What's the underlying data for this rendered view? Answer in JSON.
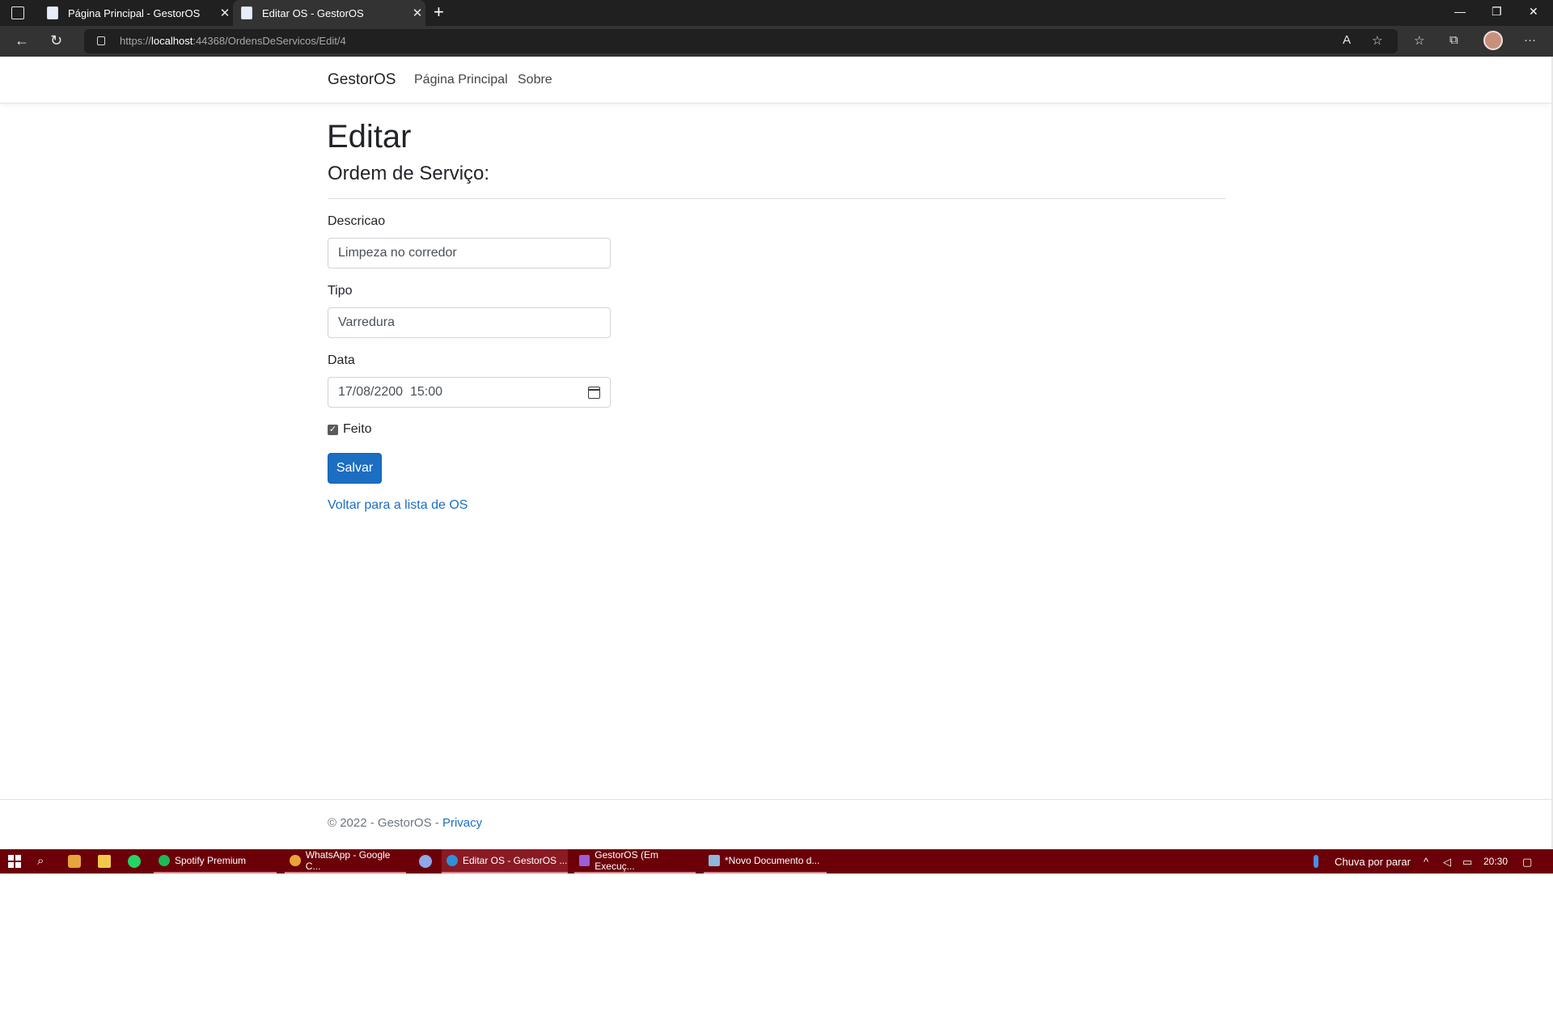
{
  "browser": {
    "tabs": [
      {
        "title": "Página Principal - GestorOS"
      },
      {
        "title": "Editar OS - GestorOS"
      }
    ],
    "url": {
      "scheme": "https://",
      "host": "localhost",
      "rest": ":44368/OrdensDeServicos/Edit/4"
    }
  },
  "nav": {
    "brand": "GestorOS",
    "links": [
      "Página Principal",
      "Sobre"
    ]
  },
  "page": {
    "title": "Editar",
    "subtitle": "Ordem de Serviço:"
  },
  "form": {
    "descricao": {
      "label": "Descricao",
      "value": "Limpeza no corredor"
    },
    "tipo": {
      "label": "Tipo",
      "value": "Varredura"
    },
    "data": {
      "label": "Data",
      "value": "17/08/2200  15:00"
    },
    "feito": {
      "label": "Feito",
      "checked": true
    },
    "submit": "Salvar",
    "back": "Voltar para a lista de OS"
  },
  "footer": {
    "text": "© 2022 - GestorOS - ",
    "privacy": "Privacy"
  },
  "taskbar": {
    "apps": [
      {
        "label": "Spotify Premium",
        "color": "#1db954"
      },
      {
        "label": "WhatsApp - Google C...",
        "color": "#e8a33b"
      },
      {
        "label": "Editar OS - GestorOS ...",
        "color": "#2f8fd8"
      },
      {
        "label": "GestorOS (Em Execuç...",
        "color": "#9b5fd6"
      },
      {
        "label": "*Novo Documento d...",
        "color": "#8fb7d9"
      }
    ],
    "weather": "Chuva por parar",
    "time": "20:30"
  }
}
